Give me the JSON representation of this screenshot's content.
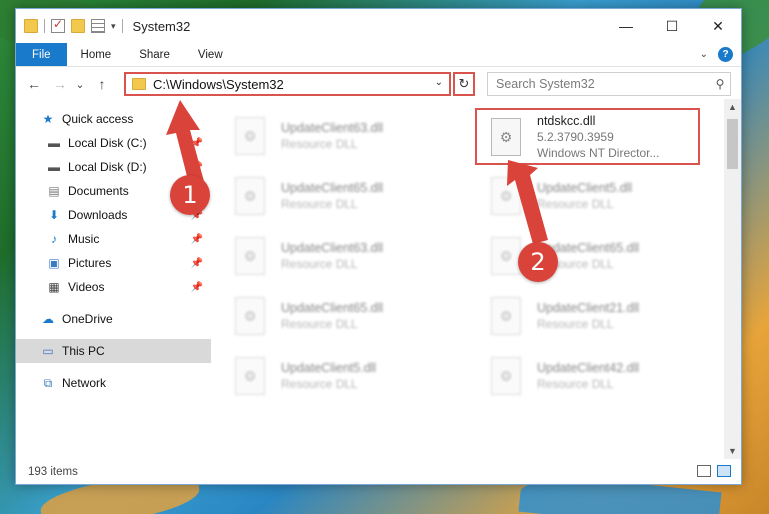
{
  "window": {
    "title": "System32"
  },
  "window_controls": {
    "minimize": "—",
    "maximize": "☐",
    "close": "✕"
  },
  "ribbon": {
    "tabs": [
      "File",
      "Home",
      "Share",
      "View"
    ]
  },
  "nav": {
    "back": "←",
    "forward": "→",
    "recent": "⌄",
    "up": "↑"
  },
  "address": {
    "path": "C:\\Windows\\System32"
  },
  "search": {
    "placeholder": "Search System32"
  },
  "sidebar": {
    "items": [
      {
        "label": "Quick access",
        "icon": "star-icon"
      },
      {
        "label": "Local Disk (C:)",
        "icon": "drive-icon"
      },
      {
        "label": "Local Disk (D:)",
        "icon": "drive-icon"
      },
      {
        "label": "Documents",
        "icon": "documents-icon"
      },
      {
        "label": "Downloads",
        "icon": "download-icon"
      },
      {
        "label": "Music",
        "icon": "music-icon"
      },
      {
        "label": "Pictures",
        "icon": "pictures-icon"
      },
      {
        "label": "Videos",
        "icon": "videos-icon"
      },
      {
        "label": "OneDrive",
        "icon": "cloud-icon"
      },
      {
        "label": "This PC",
        "icon": "computer-icon"
      },
      {
        "label": "Network",
        "icon": "network-icon"
      }
    ]
  },
  "files": {
    "highlighted": {
      "name": "ntdskcc.dll",
      "version": "5.2.3790.3959",
      "description": "Windows NT Director..."
    },
    "blurred": [
      {
        "name": "UpdateClient63.dll",
        "type": "Resource DLL"
      },
      {
        "name": "UpdateClient65.dll",
        "type": "Resource DLL"
      },
      {
        "name": "UpdateClient5.dll",
        "type": "Resource DLL"
      },
      {
        "name": "UpdateClient63.dll",
        "type": "Resource DLL"
      },
      {
        "name": "UpdateClient65.dll",
        "type": "Resource DLL"
      },
      {
        "name": "UpdateClient65.dll",
        "type": "Resource DLL"
      },
      {
        "name": "UpdateClient21.dll",
        "type": "Resource DLL"
      },
      {
        "name": "UpdateClient5.dll",
        "type": "Resource DLL"
      },
      {
        "name": "UpdateClient42.dll",
        "type": "Resource DLL"
      }
    ]
  },
  "status": {
    "items": "193 items"
  },
  "annotations": {
    "marker_1": "1",
    "marker_2": "2"
  },
  "colors": {
    "accent": "#1979ca",
    "annotation": "#d9433a"
  }
}
